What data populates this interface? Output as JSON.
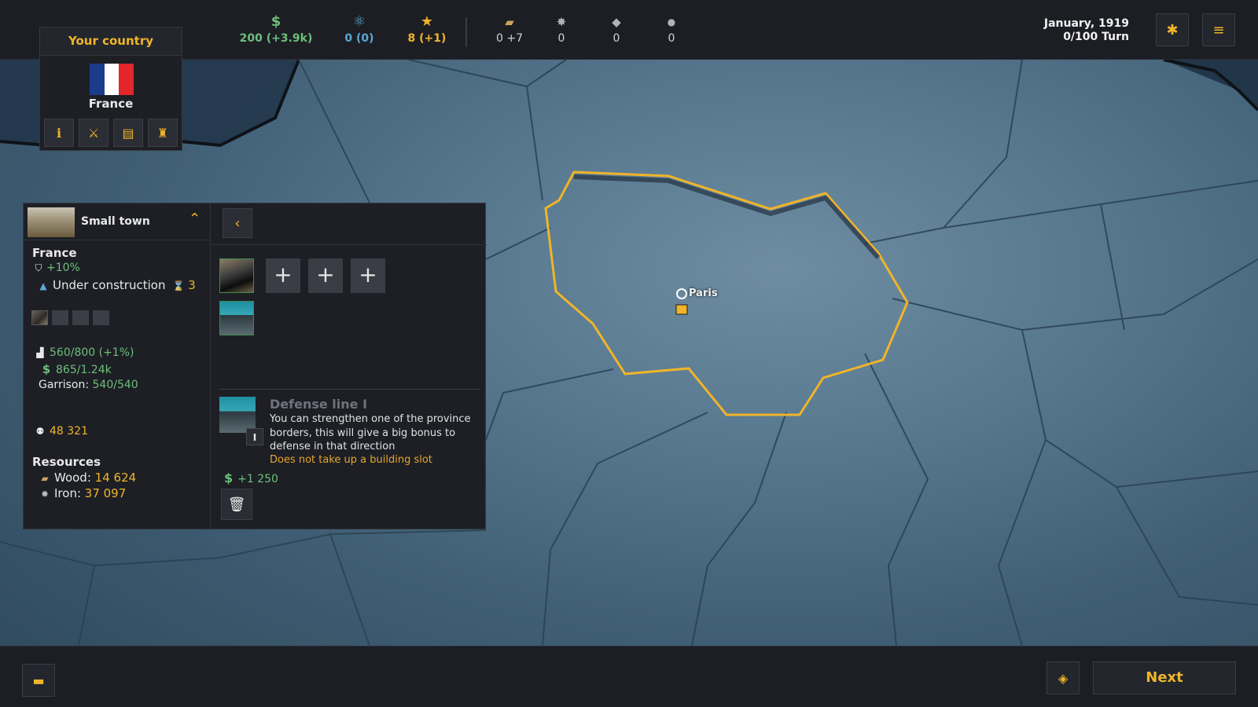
{
  "topbar": {
    "money": {
      "icon": "dollar-icon",
      "value": "200 (+3.9k)",
      "color": "#6dbf7a"
    },
    "science": {
      "icon": "atom-icon",
      "value": "0 (0)",
      "color": "#5aa8d8"
    },
    "prestige": {
      "icon": "star-icon",
      "value": "8 (+1)",
      "color": "#f0b429"
    },
    "wood": {
      "icon": "wood-icon",
      "value": "0 +7"
    },
    "iron": {
      "icon": "iron-icon",
      "value": "0"
    },
    "steel": {
      "icon": "steel-icon",
      "value": "0"
    },
    "oil": {
      "icon": "oil-drop-icon",
      "value": "0"
    },
    "date": "January, 1919",
    "turn": "0/100 Turn"
  },
  "country": {
    "header": "Your country",
    "name": "France",
    "flag_colors": [
      "#1b3c8c",
      "#ffffff",
      "#e2262b"
    ]
  },
  "province": {
    "title": "Small town",
    "owner": "France",
    "defense_bonus": "+10%",
    "construction_label": "Under construction",
    "construction_turns": "3",
    "population_stat": "560/800 (+1%)",
    "money_stat": "865/1.24k",
    "garrison_label": "Garrison:",
    "garrison_value": "540/540",
    "people": "48 321",
    "resources_header": "Resources",
    "wood_label": "Wood:",
    "wood_value": "14 624",
    "iron_label": "Iron:",
    "iron_value": "37 097"
  },
  "building": {
    "name": "Defense line I",
    "level": "I",
    "description": "You can strengthen one of the province borders, this will give a big bonus to defense in that direction",
    "note": "Does not take up a building slot",
    "cost": "+1 250"
  },
  "map": {
    "city": "Paris"
  },
  "bottombar": {
    "next_label": "Next"
  }
}
